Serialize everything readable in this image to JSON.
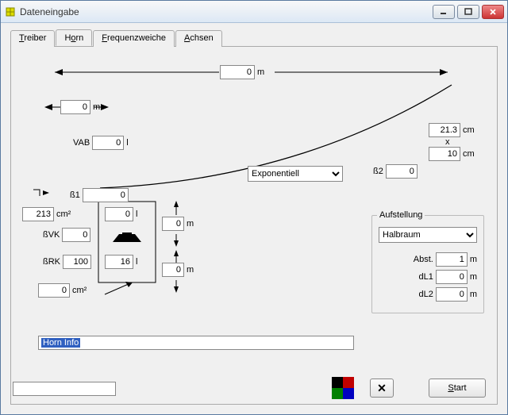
{
  "window": {
    "title": "Dateneingabe"
  },
  "tabs": {
    "t0": "Treiber",
    "t1": "Horn",
    "t2": "Frequenzweiche",
    "t3": "Achsen",
    "active": 1
  },
  "fields": {
    "top_width": {
      "value": "0",
      "unit": "m"
    },
    "left_width": {
      "value": "0",
      "unit": "m"
    },
    "vab": {
      "label": "VAB",
      "value": "0",
      "unit": "l"
    },
    "expansion": {
      "value": "Exponentiell"
    },
    "beta1": {
      "label": "ß1",
      "value": "0"
    },
    "beta2": {
      "label": "ß2",
      "value": "0"
    },
    "throat_w": {
      "value": "213",
      "unit": "cm²"
    },
    "bvk": {
      "label": "ßVK",
      "value": "0"
    },
    "brk": {
      "label": "ßRK",
      "value": "100"
    },
    "vol1": {
      "value": "0",
      "unit": "l"
    },
    "vol2": {
      "value": "16",
      "unit": "l"
    },
    "h_top": {
      "value": "0",
      "unit": "m"
    },
    "h_bot": {
      "value": "0",
      "unit": "m"
    },
    "area_bottom": {
      "value": "0",
      "unit": "cm²"
    },
    "mouth_h": {
      "value": "21.3",
      "unit": "cm"
    },
    "mouth_x": {
      "label": "x"
    },
    "mouth_w": {
      "value": "10",
      "unit": "cm"
    }
  },
  "aufstellung": {
    "title": "Aufstellung",
    "combo": "Halbraum",
    "abst": {
      "label": "Abst.",
      "value": "1",
      "unit": "m"
    },
    "dl1": {
      "label": "dL1",
      "value": "0",
      "unit": "m"
    },
    "dl2": {
      "label": "dL2",
      "value": "0",
      "unit": "m"
    }
  },
  "horn_info": {
    "label": "Horn Info"
  },
  "buttons": {
    "start": "Start"
  },
  "swatches": [
    "#000000",
    "#c00000",
    "#008000",
    "#0000c0"
  ]
}
